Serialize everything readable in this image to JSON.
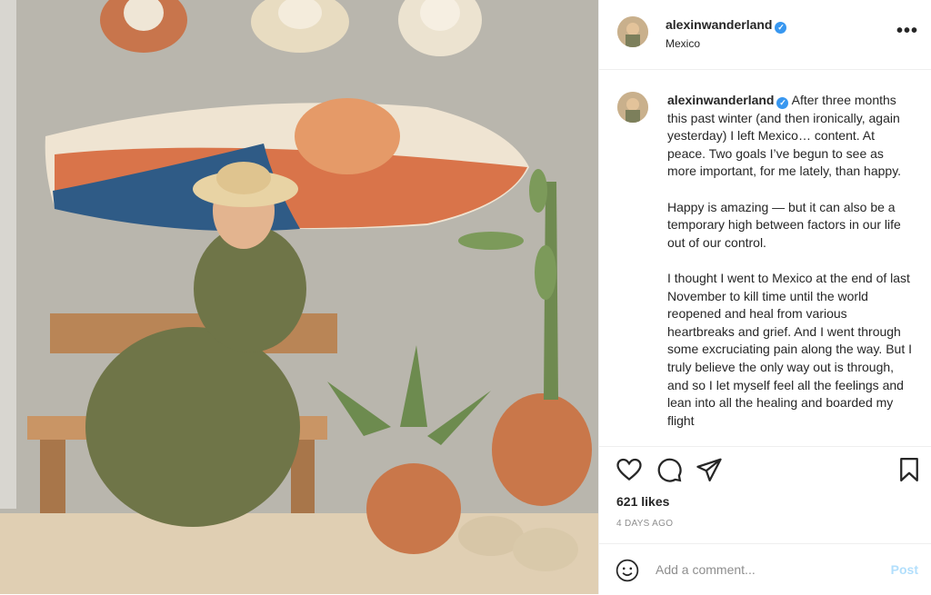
{
  "post": {
    "username": "alexinwanderland",
    "location": "Mexico",
    "verified_glyph": "✓",
    "more_glyph": "•••"
  },
  "caption": {
    "username": "alexinwanderland",
    "paragraphs": [
      "After three months this past winter (and then ironically, again yesterday) I left Mexico… content. At peace. Two goals I’ve begun to see as more important, for me lately, than happy.",
      "Happy is amazing — but it can also be a temporary high between factors in our life out of our control.",
      "I thought I went to Mexico at the end of last November to kill time until the world reopened and heal from various heartbreaks and grief. And I went through some excruciating pain along the way. But I truly believe the only way out is through, and so I let myself feel all the feelings and lean into all the healing and boarded my flight"
    ]
  },
  "actions": {
    "icons": [
      "heart-icon",
      "comment-icon",
      "share-icon",
      "bookmark-icon"
    ]
  },
  "likes": "621 likes",
  "timestamp": "4 DAYS AGO",
  "comment": {
    "placeholder": "Add a comment...",
    "post_label": "Post",
    "emoji_icon": "smiley-icon"
  },
  "colors": {
    "verified": "#3897f0",
    "post_disabled": "#b2dffc",
    "muted": "#8e8e8e"
  }
}
